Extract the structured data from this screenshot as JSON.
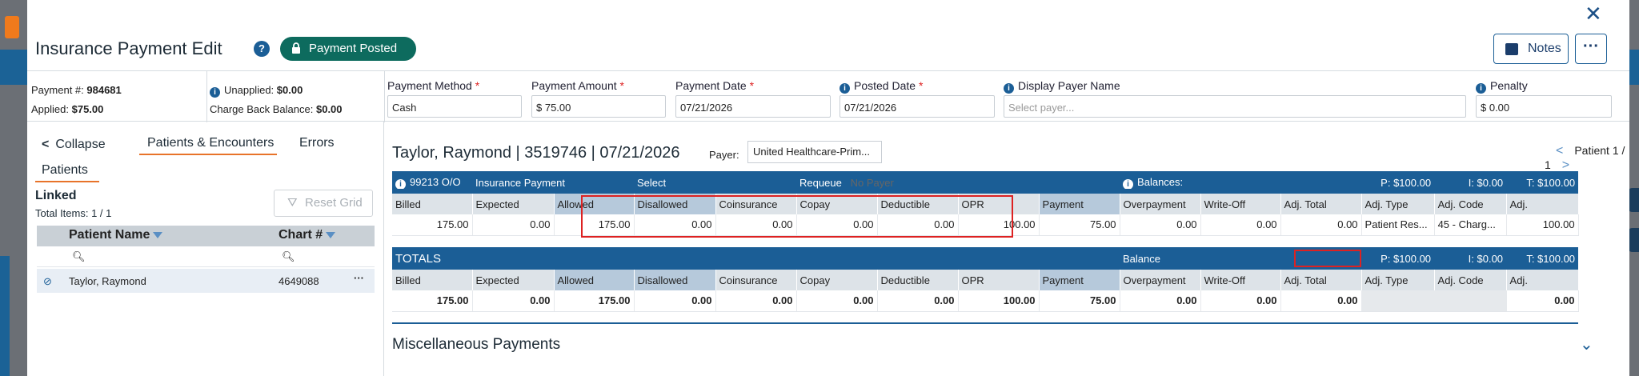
{
  "window": {
    "title": "Insurance Payment Edit",
    "status_badge": "Payment Posted",
    "notes_label": "Notes"
  },
  "summary": {
    "payment_no_label": "Payment #:",
    "payment_no": "984681",
    "applied_label": "Applied:",
    "applied": "$75.00",
    "unapplied_label": "Unapplied:",
    "unapplied": "$0.00",
    "chargeback_label": "Charge Back Balance:",
    "chargeback": "$0.00"
  },
  "fields": {
    "payment_method": {
      "label": "Payment Method",
      "value": "Cash"
    },
    "payment_amount": {
      "label": "Payment Amount",
      "value": "$ 75.00"
    },
    "payment_date": {
      "label": "Payment Date",
      "value": "07/21/2026"
    },
    "posted_date": {
      "label": "Posted Date",
      "value": "07/21/2026"
    },
    "display_payer": {
      "label": "Display Payer Name",
      "placeholder": "Select payer..."
    },
    "penalty": {
      "label": "Penalty",
      "value": "$ 0.00"
    }
  },
  "left": {
    "collapse": "Collapse",
    "tab_patients_encounters": "Patients & Encounters",
    "tab_errors": "Errors",
    "subtab_patients": "Patients",
    "linked": "Linked",
    "total_items": "Total Items: 1 / 1",
    "reset_grid": "Reset Grid",
    "col_patient_name": "Patient Name",
    "col_chart": "Chart #",
    "row": {
      "name": "Taylor, Raymond",
      "chart": "4649088"
    }
  },
  "encounter": {
    "title": "Taylor, Raymond | 3519746 | 07/21/2026",
    "payer_label": "Payer:",
    "payer": "United Healthcare-Prim...",
    "patient_nav": "Patient 1 / 1"
  },
  "line": {
    "code": "99213 O/O",
    "type": "Insurance Payment",
    "select": "Select",
    "requeue_label": "Requeue",
    "requeue_value": "No Payer",
    "balances_label": "Balances:",
    "bal_p": "P: $100.00",
    "bal_i": "I: $0.00",
    "bal_t": "T: $100.00"
  },
  "columns": [
    "Billed",
    "Expected",
    "Allowed",
    "Disallowed",
    "Coinsurance",
    "Copay",
    "Deductible",
    "OPR",
    "Payment",
    "Overpayment",
    "Write-Off",
    "Adj. Total",
    "Adj. Type",
    "Adj. Code",
    "Adj."
  ],
  "line_values": [
    "175.00",
    "0.00",
    "175.00",
    "0.00",
    "0.00",
    "0.00",
    "0.00",
    "100.00",
    "75.00",
    "0.00",
    "0.00",
    "0.00",
    "Patient Res...",
    "45 - Charg...",
    "100.00"
  ],
  "totals": {
    "label": "TOTALS",
    "balance_label": "Balance",
    "bal_p": "P: $100.00",
    "bal_i": "I: $0.00",
    "bal_t": "T: $100.00"
  },
  "totals_values": [
    "175.00",
    "0.00",
    "175.00",
    "0.00",
    "0.00",
    "0.00",
    "0.00",
    "100.00",
    "75.00",
    "0.00",
    "0.00",
    "0.00",
    "",
    "",
    "0.00"
  ],
  "misc": {
    "title": "Miscellaneous Payments"
  }
}
